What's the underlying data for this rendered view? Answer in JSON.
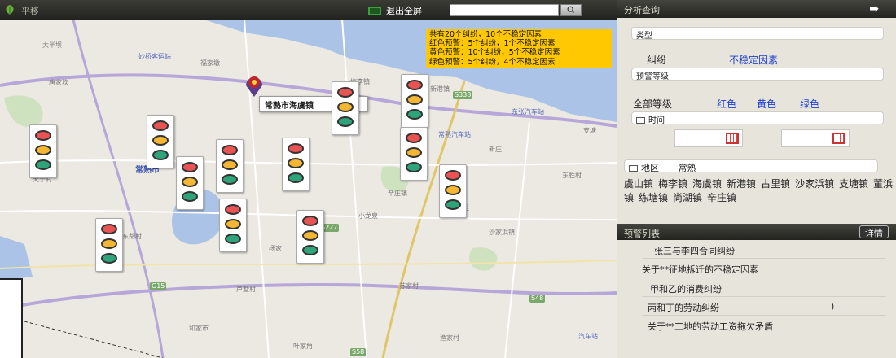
{
  "toolbar": {
    "brand": "平移",
    "exit_fullscreen": "退出全屏",
    "search_value": ""
  },
  "summary": {
    "lines": [
      "共有20个纠纷，10个不稳定因素",
      "红色预警：5个纠纷，1个不稳定因素",
      "黄色预警：10个纠纷，5个不稳定因素",
      "绿色预警：5个纠纷，4个不稳定因素"
    ]
  },
  "map": {
    "location_label": "常熟市海虞镇",
    "city_label": "常熟市",
    "place_labels": [
      "大半坝",
      "妙桥客运站",
      "福家墩",
      "唐家坎",
      "梅李镇",
      "新港镇",
      "东张汽车站",
      "支塘",
      "常熟汽车站",
      "新庄",
      "辛庄镇",
      "小龙泉",
      "东胜村",
      "天宁村",
      "东胡村",
      "古里",
      "沙家浜镇",
      "芦墅村",
      "和家市",
      "杨家",
      "苏家村",
      "渔家村",
      "叶家角",
      "汽车站"
    ],
    "road_shields": [
      "S338",
      "S227",
      "G15",
      "S48",
      "S58"
    ]
  },
  "panel": {
    "title": "分析查询",
    "type_field": "类型",
    "type_options": [
      "纠纷",
      "不稳定因素"
    ],
    "level_field": "预警等级",
    "level_options": [
      "全部等级",
      "红色",
      "黄色",
      "绿色"
    ],
    "time_field": "时间",
    "region_field": "地区",
    "region_value": "常熟",
    "towns": [
      "虞山镇",
      "梅李镇",
      "海虞镇",
      "新港镇",
      "古里镇",
      "沙家浜镇",
      "支塘镇",
      "董浜镇",
      "练塘镇",
      "尚湖镇",
      "辛庄镇"
    ],
    "list_title": "预警列表",
    "detail_button": "详情",
    "warnings": [
      "张三与李四合同纠纷",
      "关于**征地拆迁的不稳定因素",
      "甲和乙的消费纠纷",
      "丙和丁的劳动纠纷",
      "关于**工地的劳动工资拖欠矛盾"
    ],
    "row4_suffix": ")"
  },
  "colors": {
    "red": "#e85454",
    "yellow": "#f5b733",
    "green": "#2fa37a",
    "summary_bg": "#ffc800",
    "link_blue": "#1d3fcf"
  }
}
